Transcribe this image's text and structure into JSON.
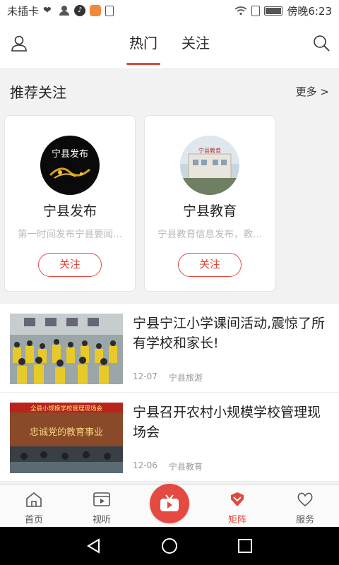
{
  "status_bar": {
    "carrier": "未插卡",
    "time": "傍晚6:23",
    "left_icons": [
      "heart-pulse-icon",
      "person-icon",
      "tiktok-icon",
      "app-notification-icon",
      "download-icon"
    ],
    "right_icons": [
      "wifi-icon",
      "sim-alert-icon",
      "battery-icon"
    ]
  },
  "header": {
    "tabs": [
      {
        "label": "热门",
        "active": true
      },
      {
        "label": "关注",
        "active": false
      }
    ],
    "left_icon": "user-icon",
    "right_icon": "search-icon"
  },
  "recommend": {
    "title": "推荐关注",
    "more": "更多 >",
    "cards": [
      {
        "name": "宁县发布",
        "desc": "第一时间发布宁县要闻...",
        "follow": "关注",
        "avatar_text": "宁县发布"
      },
      {
        "name": "宁县教育",
        "desc": "宁县教育信息发布，教...",
        "follow": "关注",
        "avatar_text": "宁县教育"
      }
    ]
  },
  "feed": [
    {
      "title": "宁县宁江小学课间活动,震惊了所有学校和家长!",
      "date": "12-07",
      "source": "宁县旅游"
    },
    {
      "title": "宁县召开农村小规模学校管理现场会",
      "date": "12-06",
      "source": "宁县教育",
      "banner_text": "全县小规模学校管理现场会",
      "slogan": "忠诚党的教育事业"
    }
  ],
  "bottom_nav": {
    "items": [
      {
        "label": "首页",
        "icon": "home-icon",
        "active": false
      },
      {
        "label": "视听",
        "icon": "video-icon",
        "active": false
      },
      {
        "label": "",
        "icon": "tv-play-icon",
        "active": false
      },
      {
        "label": "矩阵",
        "icon": "matrix-icon",
        "active": true
      },
      {
        "label": "服务",
        "icon": "heart-icon",
        "active": false
      }
    ]
  },
  "colors": {
    "accent": "#e0483b",
    "text": "#222222",
    "muted": "#999999"
  }
}
